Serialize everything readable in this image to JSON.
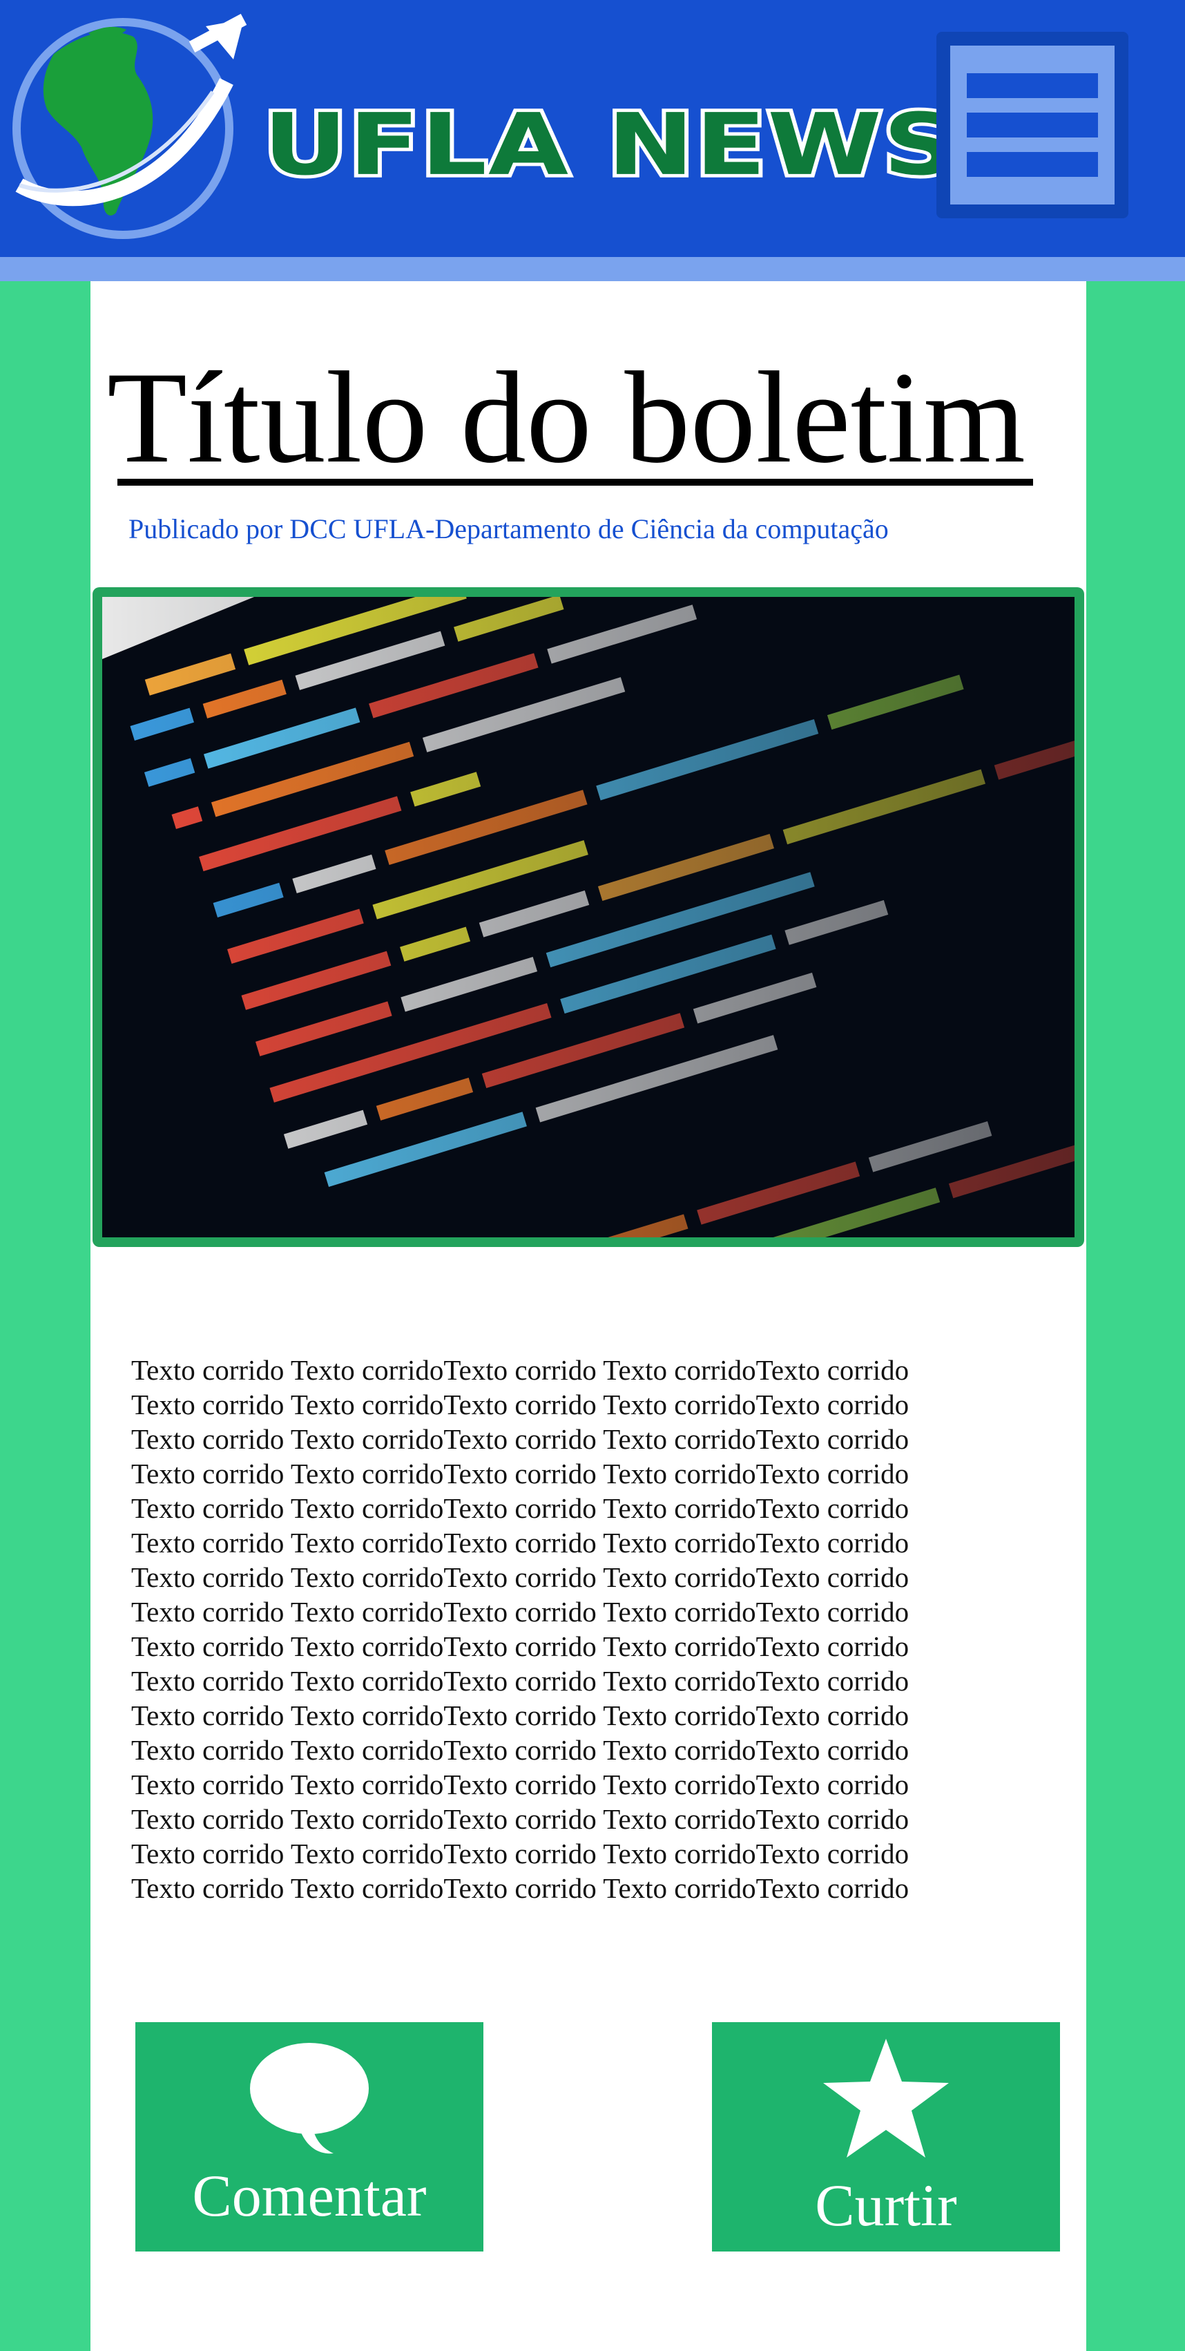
{
  "header": {
    "brand": "UFLA NEWS",
    "logo_icon": "globe-logo-icon",
    "menu_icon": "hamburger-menu-icon"
  },
  "article": {
    "title": "Título do boletim",
    "byline": "Publicado por DCC UFLA-Departamento de Ciência da computação",
    "image_icon": "code-screenshot-image",
    "body_lines": [
      "Texto corrido Texto corridoTexto corrido Texto corridoTexto corrido",
      "Texto corrido Texto corridoTexto corrido Texto corridoTexto corrido",
      "Texto corrido Texto corridoTexto corrido Texto corridoTexto corrido",
      "Texto corrido Texto corridoTexto corrido Texto corridoTexto corrido",
      "Texto corrido Texto corridoTexto corrido Texto corridoTexto corrido",
      "Texto corrido Texto corridoTexto corrido Texto corridoTexto corrido",
      "Texto corrido Texto corridoTexto corrido Texto corridoTexto corrido",
      "Texto corrido Texto corridoTexto corrido Texto corridoTexto corrido",
      "Texto corrido Texto corridoTexto corrido Texto corridoTexto corrido",
      "Texto corrido Texto corridoTexto corrido Texto corridoTexto corrido",
      "Texto corrido Texto corridoTexto corrido Texto corridoTexto corrido",
      "Texto corrido Texto corridoTexto corrido Texto corridoTexto corrido",
      "Texto corrido Texto corridoTexto corrido Texto corridoTexto corrido",
      "Texto corrido Texto corridoTexto corrido Texto corridoTexto corrido",
      "Texto corrido Texto corridoTexto corrido Texto corridoTexto corrido",
      "Texto corrido Texto corridoTexto corrido Texto corridoTexto corrido"
    ]
  },
  "actions": {
    "comment_label": "Comentar",
    "comment_icon": "speech-bubble-icon",
    "like_label": "Curtir",
    "like_icon": "star-icon"
  },
  "colors": {
    "header_blue": "#1650d0",
    "header_light": "#7aa3ee",
    "background_green": "#3dd68c",
    "button_green": "#1eb46d",
    "brand_green": "#0e7a3a",
    "byline_blue": "#1650d0"
  }
}
